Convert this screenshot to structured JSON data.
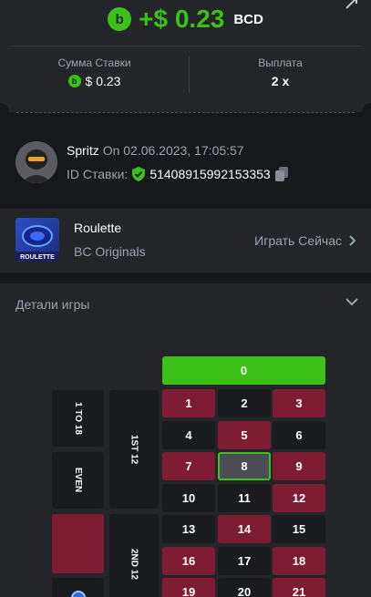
{
  "payout": {
    "logo": "b",
    "amount": "+$ 0.23",
    "currency": "BCD"
  },
  "stats": {
    "bet_label": "Сумма Ставки",
    "bet_value": "$ 0.23",
    "payout_label": "Выплата",
    "payout_value": "2 x"
  },
  "user": {
    "name": "Spritz",
    "date": "On 02.06.2023, 17:05:57",
    "bet_id_label": "ID Ставки:",
    "bet_id": "51408915992153353"
  },
  "game": {
    "name": "Roulette",
    "provider": "BC Originals",
    "play_label": "Играть Сейчас",
    "thumb_label": "ROULETTE"
  },
  "details": {
    "title": "Детали игры"
  },
  "board": {
    "zero": "0",
    "side_labels": [
      "1 TO 18",
      "EVEN"
    ],
    "dozen_labels": [
      "1ST 12",
      "2ND 12"
    ],
    "numbers": [
      {
        "n": "1",
        "c": "red"
      },
      {
        "n": "2",
        "c": "black"
      },
      {
        "n": "3",
        "c": "red"
      },
      {
        "n": "4",
        "c": "black"
      },
      {
        "n": "5",
        "c": "red"
      },
      {
        "n": "6",
        "c": "black"
      },
      {
        "n": "7",
        "c": "red"
      },
      {
        "n": "8",
        "c": "selected"
      },
      {
        "n": "9",
        "c": "red"
      },
      {
        "n": "10",
        "c": "black"
      },
      {
        "n": "11",
        "c": "black"
      },
      {
        "n": "12",
        "c": "red"
      },
      {
        "n": "13",
        "c": "black"
      },
      {
        "n": "14",
        "c": "red"
      },
      {
        "n": "15",
        "c": "black"
      },
      {
        "n": "16",
        "c": "red"
      },
      {
        "n": "17",
        "c": "black"
      },
      {
        "n": "18",
        "c": "red"
      },
      {
        "n": "19",
        "c": "red"
      },
      {
        "n": "20",
        "c": "black"
      },
      {
        "n": "21",
        "c": "red"
      }
    ]
  },
  "colors": {
    "accent": "#3bc117",
    "red": "#7d1c32",
    "panel": "#232529",
    "bg": "#17181b"
  }
}
